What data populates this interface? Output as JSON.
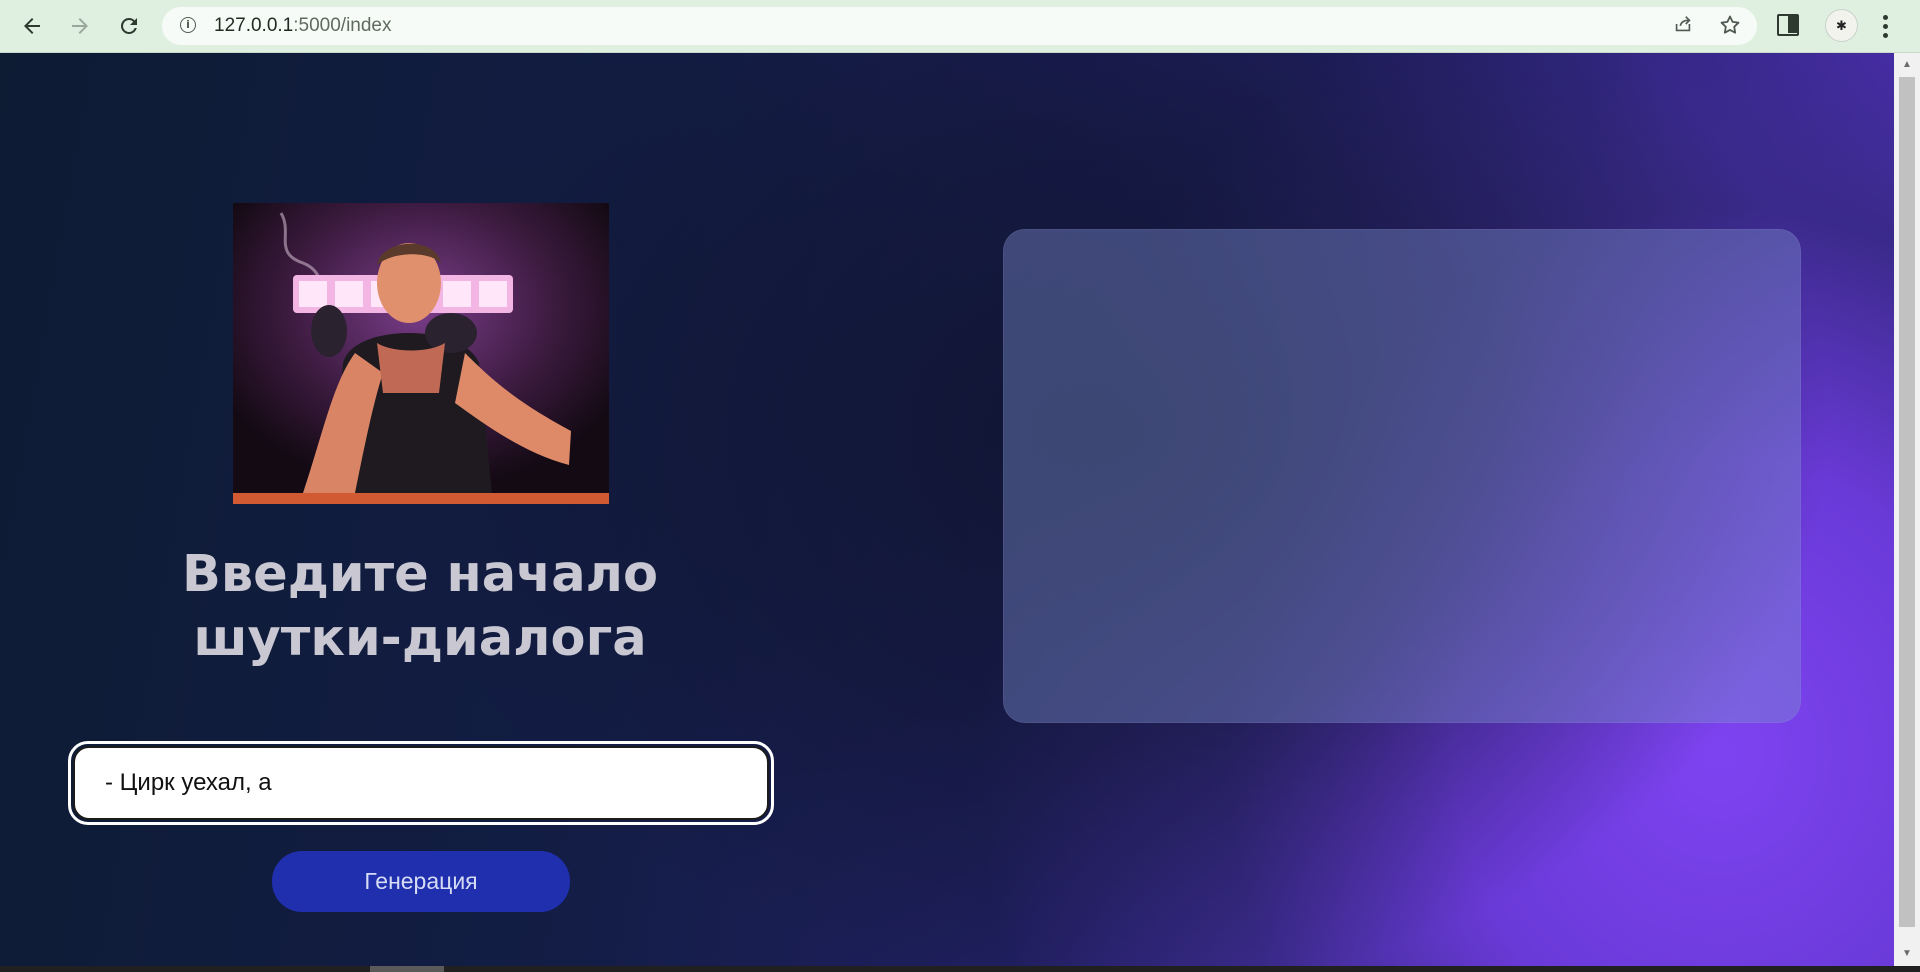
{
  "browser": {
    "url_host": "127.0.0.1",
    "url_rest": ":5000/index",
    "icons": {
      "back": "arrow-left-icon",
      "forward": "arrow-right-icon",
      "reload": "reload-icon",
      "info": "info-icon",
      "share": "share-icon",
      "bookmark": "star-icon",
      "side_panel": "side-panel-icon",
      "menu": "more-vert-icon"
    }
  },
  "page": {
    "heading": "Введите начало шутки-диалога",
    "input_value": "- Цирк уехал, а ",
    "generate_label": "Генерация",
    "result_text": ""
  },
  "colors": {
    "button_bg": "#1f2fae",
    "heading": "#c8c7d2",
    "accent_glow": "#7e43f1"
  }
}
